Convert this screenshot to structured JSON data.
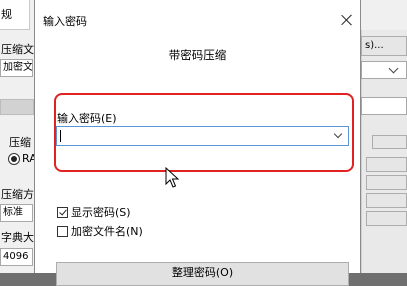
{
  "background": {
    "tab_general": "规",
    "labels": [
      "压缩文",
      "压缩",
      "压缩方",
      "字典大"
    ],
    "fields": [
      "加密文",
      "标准",
      "4096"
    ],
    "radio_label": "RA",
    "partial_button_text": "s)..."
  },
  "dialog": {
    "title": "输入密码",
    "subtitle": "带密码压缩",
    "password_label": "输入密码(E)",
    "password_value": "",
    "show_password_label": "显示密码(S)",
    "show_password_checked": true,
    "encrypt_filenames_label": "加密文件名(N)",
    "encrypt_filenames_checked": false,
    "organize_button_label": "整理密码(O)"
  },
  "colors": {
    "highlight_border": "#e02222",
    "field_focus_border": "#5a96d6",
    "dialog_background": "#ffffff"
  },
  "icons": [
    "close-icon",
    "chevron-down-icon",
    "mouse-cursor-icon",
    "checkmark-icon"
  ]
}
